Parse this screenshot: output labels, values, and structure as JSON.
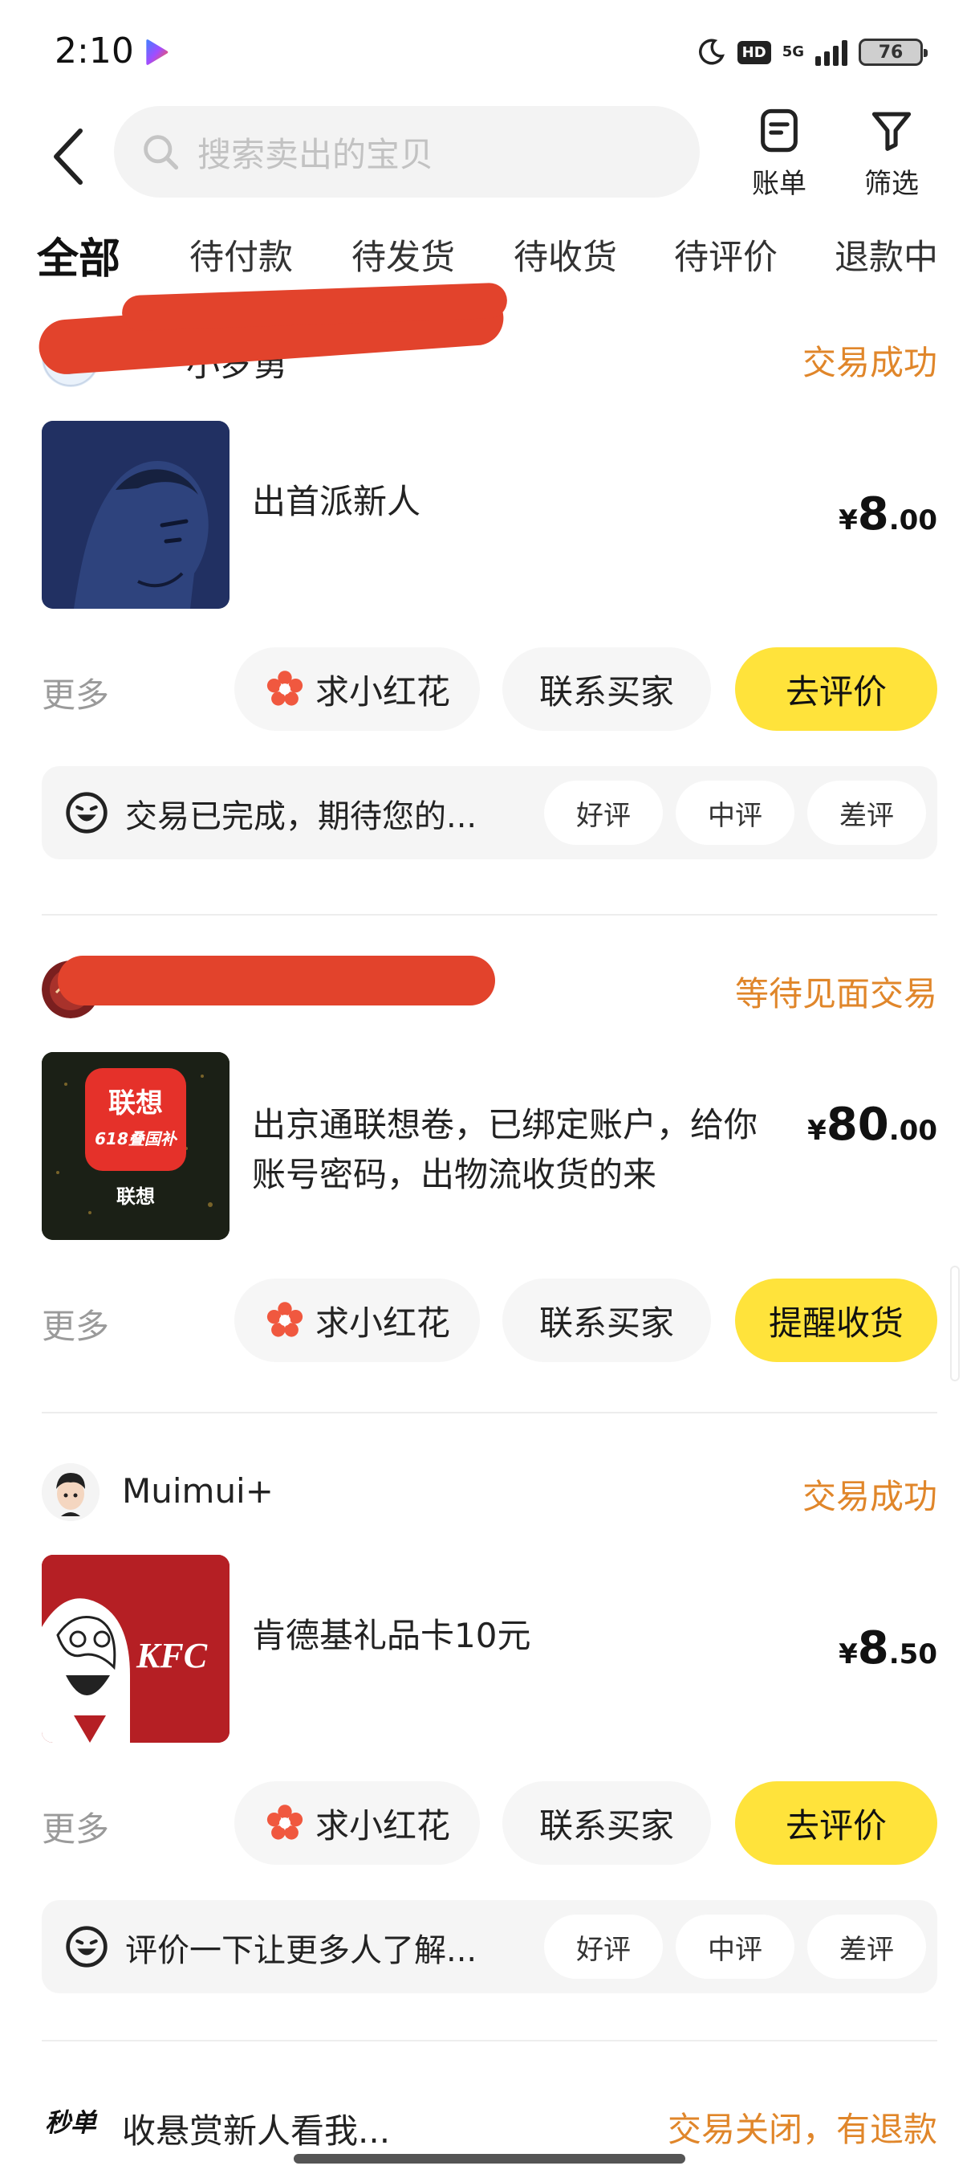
{
  "status_bar": {
    "time": "2:10",
    "battery": "76",
    "network": "5G",
    "hd": "HD"
  },
  "search": {
    "placeholder": "搜索卖出的宝贝"
  },
  "header_actions": {
    "bill": "账单",
    "filter": "筛选"
  },
  "tabs": [
    "全部",
    "待付款",
    "待发货",
    "待收货",
    "待评价",
    "退款中"
  ],
  "orders": [
    {
      "seller": "小罗勇",
      "status": "交易成功",
      "title": "出首派新人",
      "price_int": "8",
      "price_dec": ".00",
      "more": "更多",
      "flower_btn": "求小红花",
      "contact_btn": "联系买家",
      "primary_btn": "去评价",
      "review_prompt": "交易已完成，期待您的...",
      "ratings": [
        "好评",
        "中评",
        "差评"
      ]
    },
    {
      "seller": "",
      "status": "等待见面交易",
      "title": "出京通联想卷，已绑定账户，给你账号密码，出物流收货的来",
      "thumb_text": {
        "brand": "联想",
        "sub": "618叠国补",
        "footer": "联想"
      },
      "price_int": "80",
      "price_dec": ".00",
      "more": "更多",
      "flower_btn": "求小红花",
      "contact_btn": "联系买家",
      "primary_btn": "提醒收货"
    },
    {
      "seller": "Muimui+",
      "status": "交易成功",
      "title": "肯德基礼品卡10元",
      "thumb_text": {
        "brand": "KFC"
      },
      "price_int": "8",
      "price_dec": ".50",
      "more": "更多",
      "flower_btn": "求小红花",
      "contact_btn": "联系买家",
      "primary_btn": "去评价",
      "review_prompt": "评价一下让更多人了解...",
      "ratings": [
        "好评",
        "中评",
        "差评"
      ]
    },
    {
      "seller_badge": "秒单",
      "seller": "收悬赏新人看我...",
      "status": "交易关闭，有退款"
    }
  ],
  "currency": "¥",
  "colors": {
    "accent_yellow": "#ffe33b",
    "status_orange": "#e0862a",
    "redaction": "#e2432c"
  }
}
